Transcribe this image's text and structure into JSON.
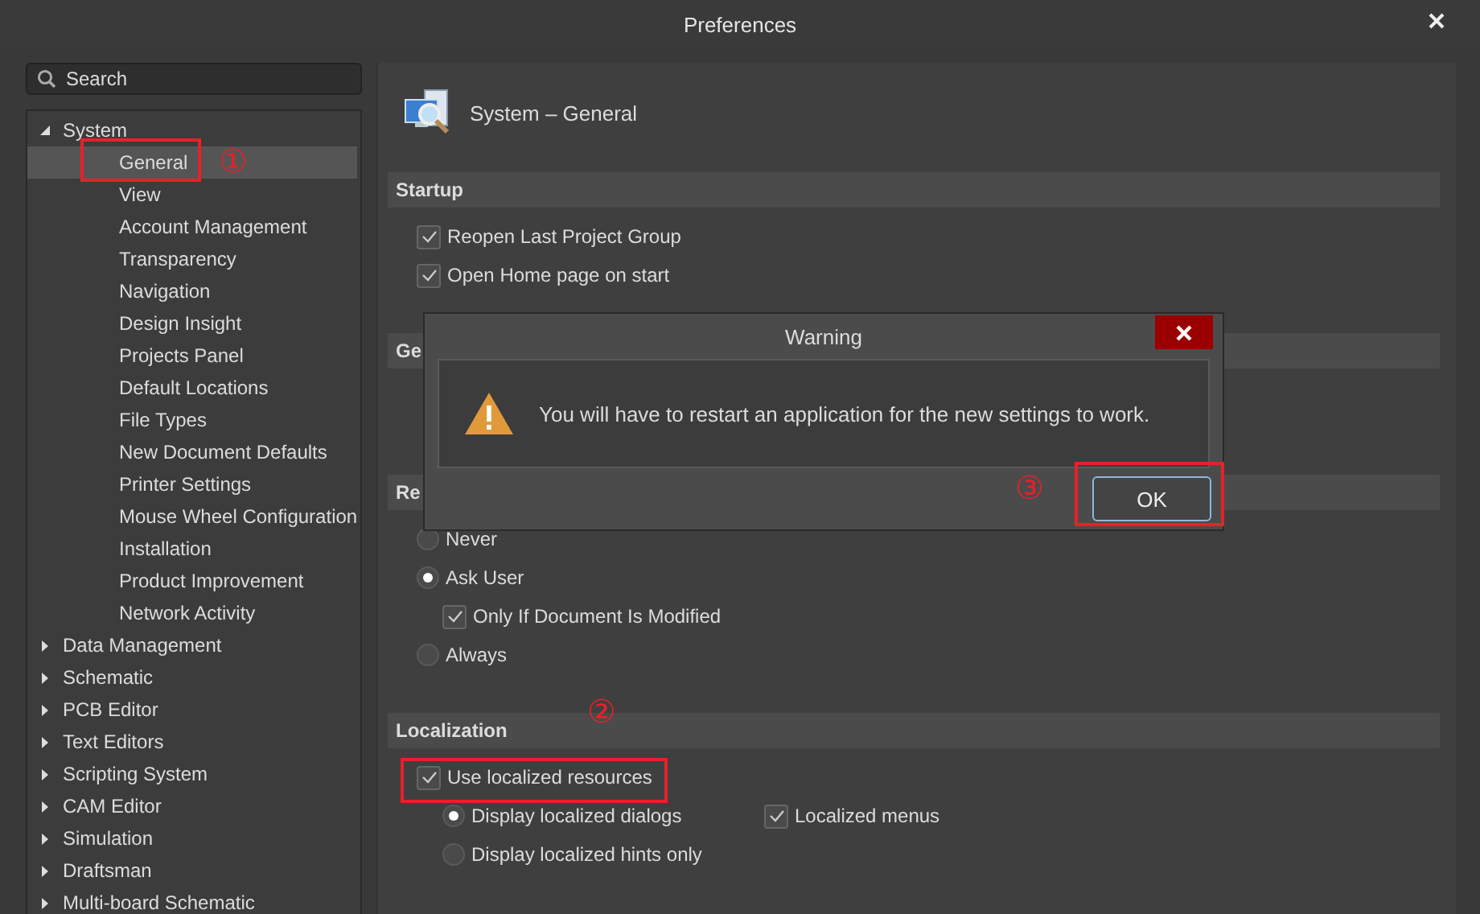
{
  "window": {
    "title": "Preferences"
  },
  "search": {
    "placeholder": "Search"
  },
  "tree": [
    {
      "label": "System",
      "expanded": true,
      "selected": false,
      "children": [
        {
          "label": "General",
          "selected": true
        },
        {
          "label": "View",
          "selected": false
        },
        {
          "label": "Account Management",
          "selected": false
        },
        {
          "label": "Transparency",
          "selected": false
        },
        {
          "label": "Navigation",
          "selected": false
        },
        {
          "label": "Design Insight",
          "selected": false
        },
        {
          "label": "Projects Panel",
          "selected": false
        },
        {
          "label": "Default Locations",
          "selected": false
        },
        {
          "label": "File Types",
          "selected": false
        },
        {
          "label": "New Document Defaults",
          "selected": false
        },
        {
          "label": "Printer Settings",
          "selected": false
        },
        {
          "label": "Mouse Wheel Configuration",
          "selected": false
        },
        {
          "label": "Installation",
          "selected": false
        },
        {
          "label": "Product Improvement",
          "selected": false
        },
        {
          "label": "Network Activity",
          "selected": false
        }
      ]
    },
    {
      "label": "Data Management",
      "expanded": false,
      "selected": false
    },
    {
      "label": "Schematic",
      "expanded": false,
      "selected": false
    },
    {
      "label": "PCB Editor",
      "expanded": false,
      "selected": false
    },
    {
      "label": "Text Editors",
      "expanded": false,
      "selected": false
    },
    {
      "label": "Scripting System",
      "expanded": false,
      "selected": false
    },
    {
      "label": "CAM Editor",
      "expanded": false,
      "selected": false
    },
    {
      "label": "Simulation",
      "expanded": false,
      "selected": false
    },
    {
      "label": "Draftsman",
      "expanded": false,
      "selected": false
    },
    {
      "label": "Multi-board Schematic",
      "expanded": false,
      "selected": false
    }
  ],
  "page": {
    "title": "System – General",
    "sections": [
      {
        "title": "Startup",
        "items": [
          {
            "kind": "checkbox",
            "label": "Reopen Last Project Group",
            "checked": true
          },
          {
            "kind": "checkbox",
            "label": "Open Home page on start",
            "checked": true
          }
        ]
      },
      {
        "title": "Ge"
      },
      {
        "title": "Re",
        "items": [
          {
            "kind": "radio",
            "label": "Never",
            "selected": false
          },
          {
            "kind": "radio",
            "label": "Ask User",
            "selected": true,
            "children": [
              {
                "kind": "checkbox",
                "label": "Only If Document Is Modified",
                "checked": true
              }
            ]
          },
          {
            "kind": "radio",
            "label": "Always",
            "selected": false
          }
        ]
      },
      {
        "title": "Localization",
        "items": [
          {
            "kind": "checkbox",
            "label": "Use localized resources",
            "checked": true,
            "children": [
              {
                "kind": "radio",
                "label": "Display localized dialogs",
                "selected": true
              },
              {
                "kind": "checkbox",
                "label": "Localized menus",
                "checked": true
              },
              {
                "kind": "radio",
                "label": "Display localized hints only",
                "selected": false
              }
            ]
          }
        ]
      }
    ]
  },
  "dialog": {
    "title": "Warning",
    "message": "You will have to restart an application for the new settings to work.",
    "button": "OK"
  },
  "annotations": [
    {
      "label": "①"
    },
    {
      "label": "②"
    },
    {
      "label": "③"
    }
  ]
}
